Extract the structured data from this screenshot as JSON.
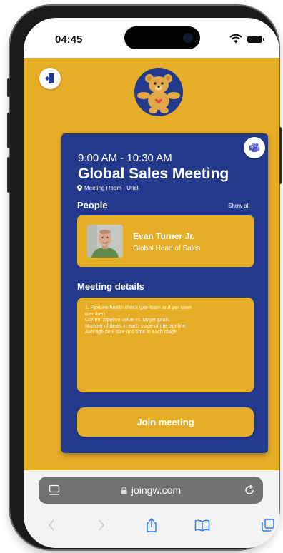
{
  "status_bar": {
    "time": "04:45"
  },
  "app": {
    "meeting": {
      "time_range": "9:00 AM - 10:30 AM",
      "title": "Global Sales Meeting",
      "room": "Meeting Room - Uriel"
    },
    "people": {
      "label": "People",
      "show_all_label": "Show all",
      "person": {
        "name": "Evan Turner Jr.",
        "role": "Global Head of Sales"
      }
    },
    "details": {
      "label": "Meeting details",
      "lines": [
        "1. Pipeline health check (per team and per team",
        "member)",
        "Current pipeline value vs. target goals.",
        "Number of deals in each stage of the pipeline.",
        "Average deal size and time in each stage."
      ]
    },
    "join_label": "Join meeting"
  },
  "browser": {
    "url": "joingw.com"
  },
  "colors": {
    "accent_yellow": "#e6ae27",
    "primary_blue": "#233a8c",
    "white": "#ffffff"
  },
  "icons": {
    "exit": "door-exit-icon",
    "teams": "microsoft-teams-icon",
    "room": "location-pin-icon",
    "url_left": "page-menu-icon",
    "lock": "lock-icon",
    "reload": "reload-icon",
    "back": "back-arrow-icon",
    "forward": "forward-arrow-icon",
    "share": "share-icon",
    "bookmarks": "bookmarks-icon",
    "tabs": "tabs-icon"
  }
}
